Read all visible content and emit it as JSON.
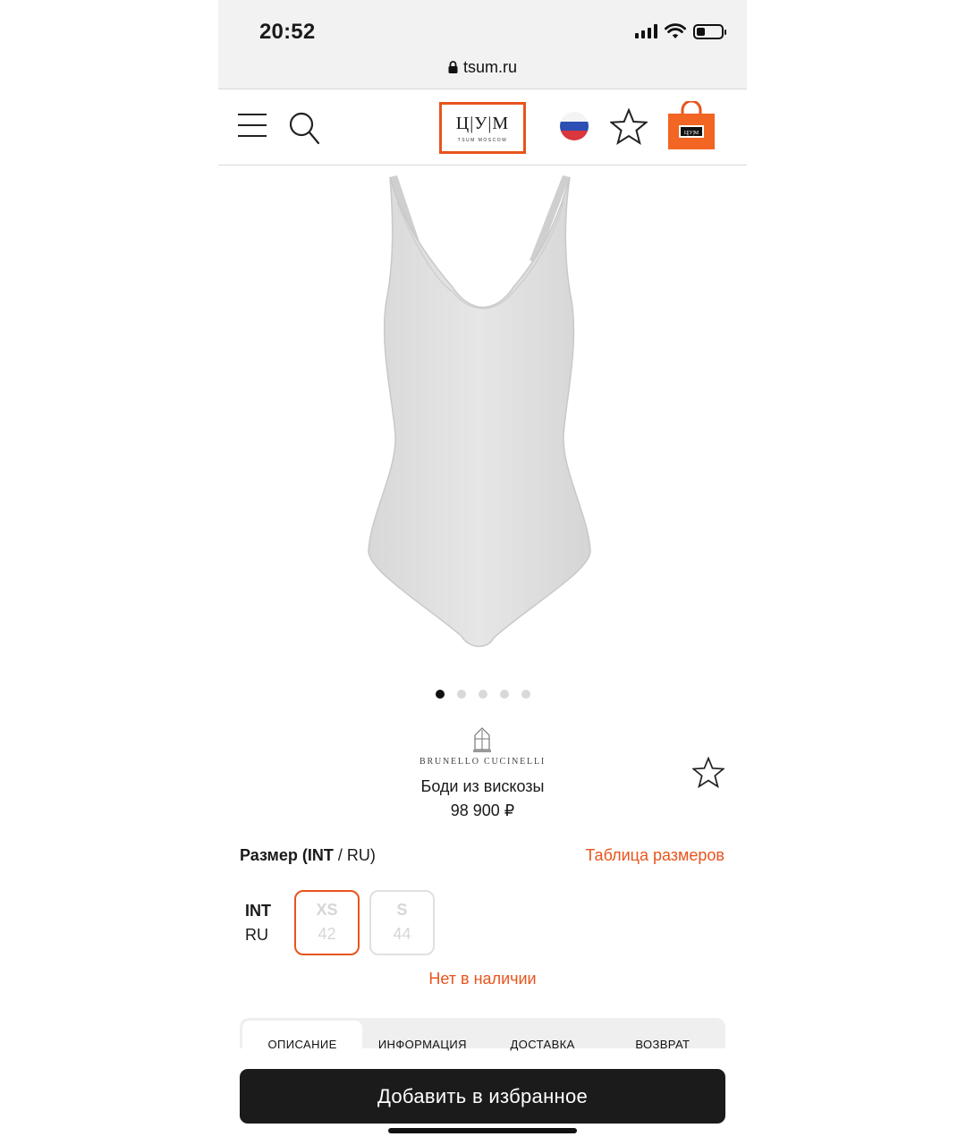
{
  "status_bar": {
    "time": "20:52",
    "icons": [
      "signal-icon",
      "wifi-icon",
      "battery-icon"
    ],
    "battery_level": 0.35
  },
  "browser": {
    "url": "tsum.ru",
    "lock_icon": "lock-icon"
  },
  "header": {
    "menu_icon": "menu-icon",
    "search_icon": "search-icon",
    "logo": {
      "letters": "Ц|У|М",
      "subtitle": "TSUM MOSCOW"
    },
    "flag_icon": "russia-flag-icon",
    "favorites_icon": "star-icon",
    "bag_icon": "shopping-bag-icon"
  },
  "gallery": {
    "total_images": 5,
    "active_index": 0
  },
  "product": {
    "brand": "BRUNELLO CUCINELLI",
    "name": "Боди из вискозы",
    "price": "98 900 ₽"
  },
  "size": {
    "title_bold": "Размер (INT",
    "title_rest": " / RU)",
    "table_link": "Таблица размеров",
    "label_int": "INT",
    "label_ru": "RU",
    "options": [
      {
        "int": "XS",
        "ru": "42",
        "selected": true
      },
      {
        "int": "S",
        "ru": "44",
        "selected": false
      }
    ],
    "availability": "Нет в наличии"
  },
  "tabs": [
    {
      "label": "ОПИСАНИЕ",
      "active": true
    },
    {
      "label": "ИНФОРМАЦИЯ",
      "active": false
    },
    {
      "label": "ДОСТАВКА",
      "active": false
    },
    {
      "label": "ВОЗВРАТ",
      "active": false
    }
  ],
  "cta": {
    "label": "Добавить в избранное"
  },
  "colors": {
    "accent": "#e8541c",
    "cta_background": "#1b1b1b",
    "chrome_background": "#f2f2f2"
  }
}
